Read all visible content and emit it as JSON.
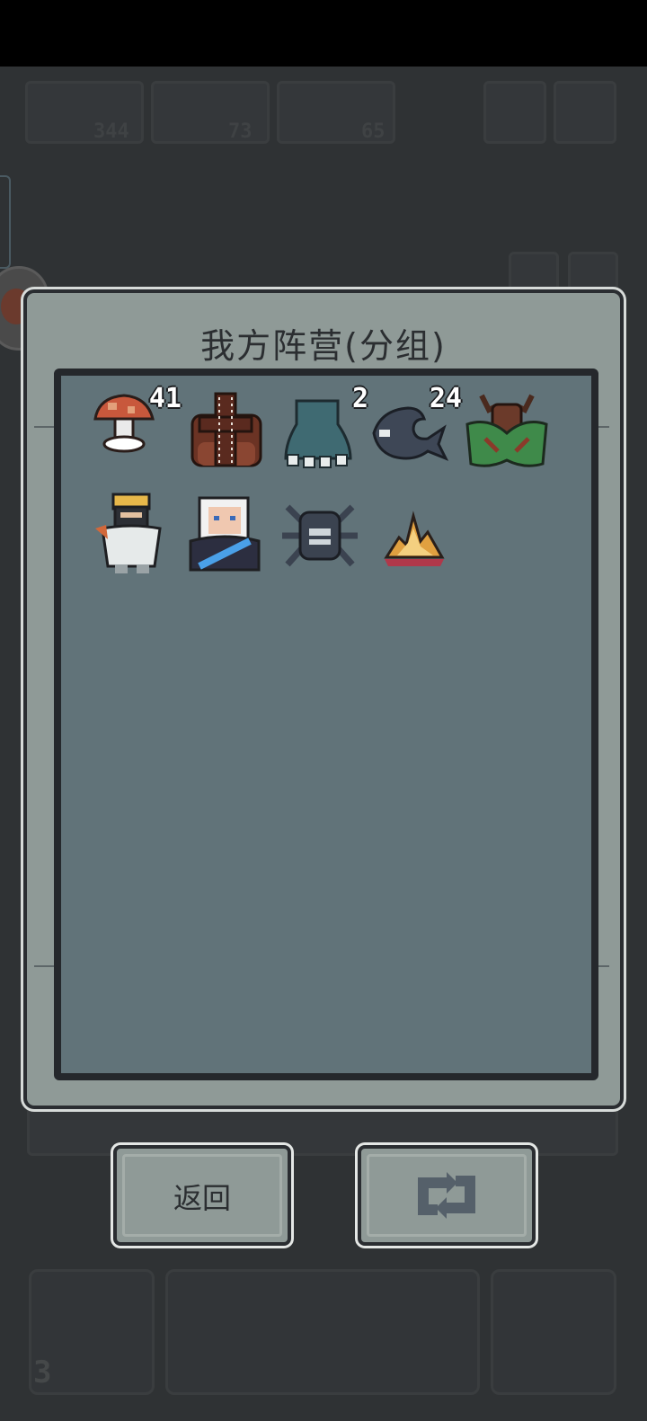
{
  "hud": {
    "stat1": "344",
    "stat2": "73",
    "stat3": "65",
    "bottom_count": "3"
  },
  "panel": {
    "title": "我方阵营(分组)"
  },
  "units": [
    {
      "name": "mushroom",
      "count": "41"
    },
    {
      "name": "brown-sack",
      "count": ""
    },
    {
      "name": "blue-ghost",
      "count": "2"
    },
    {
      "name": "grey-fish",
      "count": "24"
    },
    {
      "name": "antlered-beast",
      "count": ""
    },
    {
      "name": "blonde-warrior",
      "count": ""
    },
    {
      "name": "white-haired-sage",
      "count": ""
    },
    {
      "name": "dark-spider",
      "count": ""
    },
    {
      "name": "flame-crystal",
      "count": ""
    }
  ],
  "buttons": {
    "back_label": "返回",
    "swap_icon": "refresh-icon"
  },
  "colors": {
    "panel": "#8f9a97",
    "inner": "#617379",
    "frame": "#25282c"
  }
}
